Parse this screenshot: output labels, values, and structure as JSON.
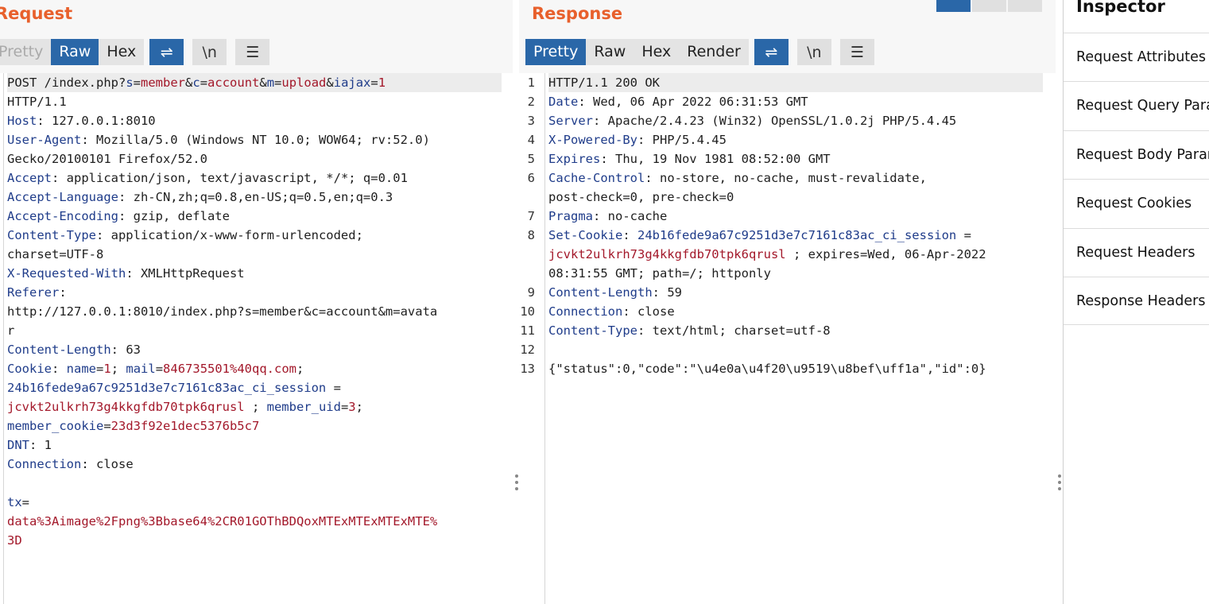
{
  "request": {
    "title": "Request",
    "tabs": [
      "Pretty",
      "Raw",
      "Hex"
    ],
    "active_tab": "Raw",
    "lines": [
      [
        {
          "t": "POST /index.php?"
        },
        {
          "t": "s",
          "c": "k"
        },
        {
          "t": "="
        },
        {
          "t": "member",
          "c": "v"
        },
        {
          "t": "&"
        },
        {
          "t": "c",
          "c": "k"
        },
        {
          "t": "="
        },
        {
          "t": "account",
          "c": "v"
        },
        {
          "t": "&"
        },
        {
          "t": "m",
          "c": "k"
        },
        {
          "t": "="
        },
        {
          "t": "upload",
          "c": "v"
        },
        {
          "t": "&"
        },
        {
          "t": "iajax",
          "c": "k"
        },
        {
          "t": "="
        },
        {
          "t": "1",
          "c": "v"
        }
      ],
      [
        {
          "t": "HTTP/1.1"
        }
      ],
      [
        {
          "t": "Host",
          "c": "k"
        },
        {
          "t": ": 127.0.0.1:8010"
        }
      ],
      [
        {
          "t": "User-Agent",
          "c": "k"
        },
        {
          "t": ": Mozilla/5.0 (Windows NT 10.0; WOW64; rv:52.0)"
        }
      ],
      [
        {
          "t": "Gecko/20100101 Firefox/52.0"
        }
      ],
      [
        {
          "t": "Accept",
          "c": "k"
        },
        {
          "t": ": application/json, text/javascript, */*; q=0.01"
        }
      ],
      [
        {
          "t": "Accept-Language",
          "c": "k"
        },
        {
          "t": ": zh-CN,zh;q=0.8,en-US;q=0.5,en;q=0.3"
        }
      ],
      [
        {
          "t": "Accept-Encoding",
          "c": "k"
        },
        {
          "t": ": gzip, deflate"
        }
      ],
      [
        {
          "t": "Content-Type",
          "c": "k"
        },
        {
          "t": ": application/x-www-form-urlencoded;"
        }
      ],
      [
        {
          "t": "charset=UTF-8"
        }
      ],
      [
        {
          "t": "X-Requested-With",
          "c": "k"
        },
        {
          "t": ": XMLHttpRequest"
        }
      ],
      [
        {
          "t": "Referer",
          "c": "k"
        },
        {
          "t": ":"
        }
      ],
      [
        {
          "t": "http://127.0.0.1:8010/index.php?s=member&c=account&m=avata"
        }
      ],
      [
        {
          "t": "r"
        }
      ],
      [
        {
          "t": "Content-Length",
          "c": "k"
        },
        {
          "t": ": 63"
        }
      ],
      [
        {
          "t": "Cookie",
          "c": "k"
        },
        {
          "t": ": "
        },
        {
          "t": "name",
          "c": "k"
        },
        {
          "t": "="
        },
        {
          "t": "1",
          "c": "v"
        },
        {
          "t": "; "
        },
        {
          "t": "mail",
          "c": "k"
        },
        {
          "t": "="
        },
        {
          "t": "846735501%40qq.com",
          "c": "v"
        },
        {
          "t": ";"
        }
      ],
      [
        {
          "t": "24b16fede9a67c9251d3e7c7161c83ac_ci_session",
          "c": "k"
        },
        {
          "t": " ="
        }
      ],
      [
        {
          "t": "jcvkt2ulkrh73g4kkgfdb70tpk6qrusl",
          "c": "v"
        },
        {
          "t": " ; "
        },
        {
          "t": "member_uid",
          "c": "k"
        },
        {
          "t": "="
        },
        {
          "t": "3",
          "c": "v"
        },
        {
          "t": ";"
        }
      ],
      [
        {
          "t": "member_cookie",
          "c": "k"
        },
        {
          "t": "="
        },
        {
          "t": "23d3f92e1dec5376b5c7",
          "c": "v"
        }
      ],
      [
        {
          "t": "DNT",
          "c": "k"
        },
        {
          "t": ": 1"
        }
      ],
      [
        {
          "t": "Connection",
          "c": "k"
        },
        {
          "t": ": close"
        }
      ],
      [
        {
          "t": ""
        }
      ],
      [
        {
          "t": "tx",
          "c": "k"
        },
        {
          "t": "="
        }
      ],
      [
        {
          "t": "data%3Aimage%2Fpng%3Bbase64%2CR01GOThBDQoxMTExMTExMTExMTE%",
          "c": "v"
        }
      ],
      [
        {
          "t": "3D",
          "c": "v"
        }
      ]
    ]
  },
  "response": {
    "title": "Response",
    "tabs": [
      "Pretty",
      "Raw",
      "Hex",
      "Render"
    ],
    "active_tab": "Pretty",
    "line_numbers": [
      "1",
      "2",
      "3",
      "4",
      "5",
      "6",
      "",
      "7",
      "8",
      "",
      "",
      "9",
      "10",
      "11",
      "12",
      "13"
    ],
    "lines": [
      [
        {
          "t": "HTTP/1.1 200 OK"
        }
      ],
      [
        {
          "t": "Date",
          "c": "k"
        },
        {
          "t": ": Wed, 06 Apr 2022 06:31:53 GMT"
        }
      ],
      [
        {
          "t": "Server",
          "c": "k"
        },
        {
          "t": ": Apache/2.4.23 (Win32) OpenSSL/1.0.2j PHP/5.4.45"
        }
      ],
      [
        {
          "t": "X-Powered-By",
          "c": "k"
        },
        {
          "t": ": PHP/5.4.45"
        }
      ],
      [
        {
          "t": "Expires",
          "c": "k"
        },
        {
          "t": ": Thu, 19 Nov 1981 08:52:00 GMT"
        }
      ],
      [
        {
          "t": "Cache-Control",
          "c": "k"
        },
        {
          "t": ": no-store, no-cache, must-revalidate,"
        }
      ],
      [
        {
          "t": "post-check=0, pre-check=0"
        }
      ],
      [
        {
          "t": "Pragma",
          "c": "k"
        },
        {
          "t": ": no-cache"
        }
      ],
      [
        {
          "t": "Set-Cookie",
          "c": "k"
        },
        {
          "t": ": "
        },
        {
          "t": "24b16fede9a67c9251d3e7c7161c83ac_ci_session",
          "c": "k"
        },
        {
          "t": " ="
        }
      ],
      [
        {
          "t": "jcvkt2ulkrh73g4kkgfdb70tpk6qrusl",
          "c": "v"
        },
        {
          "t": " ; expires=Wed, 06-Apr-2022"
        }
      ],
      [
        {
          "t": "08:31:55 GMT; path=/; httponly"
        }
      ],
      [
        {
          "t": "Content-Length",
          "c": "k"
        },
        {
          "t": ": 59"
        }
      ],
      [
        {
          "t": "Connection",
          "c": "k"
        },
        {
          "t": ": close"
        }
      ],
      [
        {
          "t": "Content-Type",
          "c": "k"
        },
        {
          "t": ": text/html; charset=utf-8"
        }
      ],
      [
        {
          "t": ""
        }
      ],
      [
        {
          "t": "{\"status\":0,\"code\":\"\\u4e0a\\u4f20\\u9519\\u8bef\\uff1a\",\"id\":0}"
        }
      ]
    ]
  },
  "toolbar_icons": {
    "wrap": "⇌",
    "newline": "\\n",
    "menu": "☰"
  },
  "inspector": {
    "title": "Inspector",
    "items": [
      "Request Attributes",
      "Request Query Parameters",
      "Request Body Parameters",
      "Request Cookies",
      "Request Headers",
      "Response Headers"
    ]
  }
}
